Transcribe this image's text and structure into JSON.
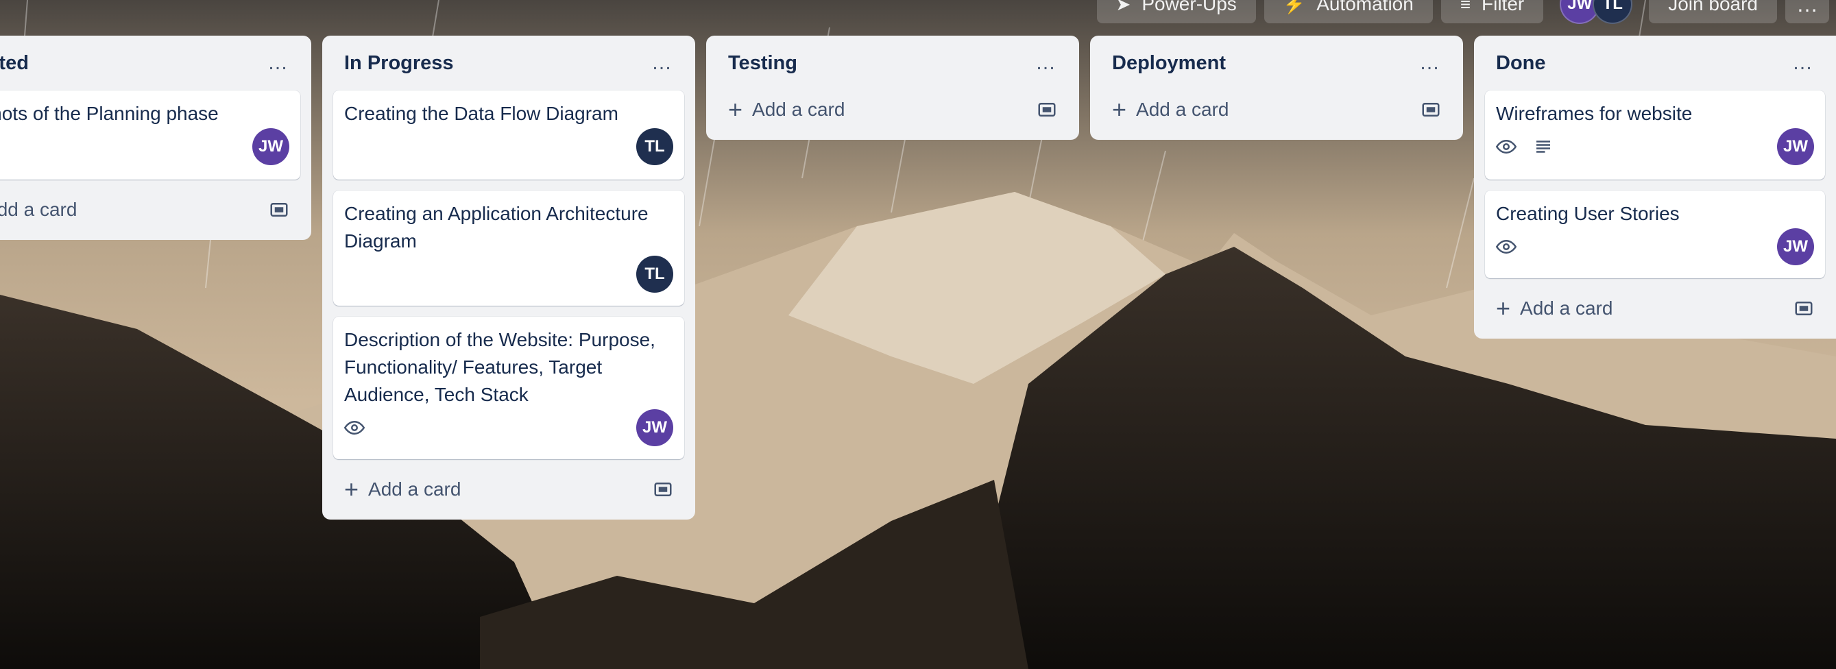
{
  "topbar": {
    "powerups_label": "Power-Ups",
    "automation_label": "Automation",
    "filter_label": "Filter",
    "members": [
      "JW",
      "TL"
    ],
    "join_label": "Join board",
    "more_label": "…"
  },
  "lists": [
    {
      "title": "Started",
      "menu": "…",
      "cards": [
        {
          "title": "enshots of the Planning phase",
          "member": "JW"
        }
      ],
      "add_label": "Add a card"
    },
    {
      "title": "In Progress",
      "menu": "…",
      "cards": [
        {
          "title": "Creating the Data Flow Diagram",
          "member": "TL"
        },
        {
          "title": "Creating an Application Architecture Diagram",
          "member": "TL"
        },
        {
          "title": "Description of the Website: Purpose, Functionality/ Features, Target Audience, Tech Stack",
          "member": "JW",
          "badges": [
            "eye-icon"
          ]
        }
      ],
      "add_label": "Add a card"
    },
    {
      "title": "Testing",
      "menu": "…",
      "cards": [],
      "add_label": "Add a card"
    },
    {
      "title": "Deployment",
      "menu": "…",
      "cards": [],
      "add_label": "Add a card"
    },
    {
      "title": "Done",
      "menu": "…",
      "cards": [
        {
          "title": "Wireframes for website",
          "member": "JW",
          "badges": [
            "eye-icon",
            "description-icon"
          ]
        },
        {
          "title": "Creating User Stories",
          "member": "JW",
          "badges": [
            "eye-icon"
          ]
        }
      ],
      "add_label": "Add a card"
    }
  ],
  "colors": {
    "list_bg": "#f1f2f4",
    "card_bg": "#ffffff",
    "text": "#172b4d",
    "avatar_jw": "#5b3fa3",
    "avatar_tl": "#1f2f4f"
  }
}
